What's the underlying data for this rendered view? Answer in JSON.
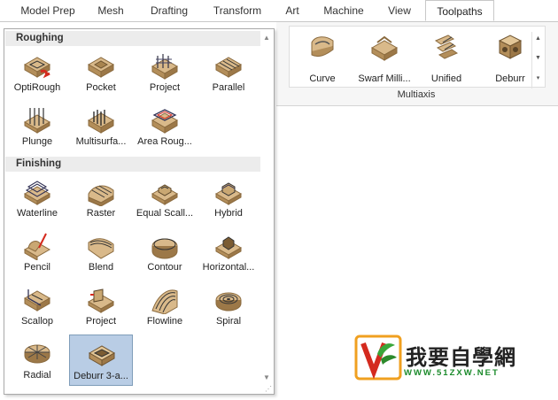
{
  "tabs": [
    {
      "label": "Model Prep",
      "active": false
    },
    {
      "label": "Mesh",
      "active": false
    },
    {
      "label": "Drafting",
      "active": false
    },
    {
      "label": "Transform",
      "active": false
    },
    {
      "label": "Art",
      "active": false
    },
    {
      "label": "Machine",
      "active": false
    },
    {
      "label": "View",
      "active": false
    },
    {
      "label": "Toolpaths",
      "active": true
    }
  ],
  "ribbon": {
    "group_label": "Multiaxis",
    "buttons": [
      {
        "label": "Curve",
        "icon": "multiaxis-curve-icon"
      },
      {
        "label": "Swarf Milli...",
        "icon": "swarf-milling-icon"
      },
      {
        "label": "Unified",
        "icon": "unified-icon"
      },
      {
        "label": "Deburr",
        "icon": "deburr-icon"
      }
    ]
  },
  "dropdown": {
    "sections": [
      {
        "title": "Roughing",
        "items": [
          {
            "label": "OptiRough",
            "icon": "optirough-icon"
          },
          {
            "label": "Pocket",
            "icon": "pocket-icon"
          },
          {
            "label": "Project",
            "icon": "project-icon"
          },
          {
            "label": "Parallel",
            "icon": "parallel-icon"
          },
          {
            "label": "Plunge",
            "icon": "plunge-icon"
          },
          {
            "label": "Multisurfa...",
            "icon": "multisurface-icon"
          },
          {
            "label": "Area Roug...",
            "icon": "area-roughing-icon"
          }
        ]
      },
      {
        "title": "Finishing",
        "items": [
          {
            "label": "Waterline",
            "icon": "waterline-icon"
          },
          {
            "label": "Raster",
            "icon": "raster-icon"
          },
          {
            "label": "Equal Scall...",
            "icon": "equal-scallop-icon"
          },
          {
            "label": "Hybrid",
            "icon": "hybrid-icon"
          },
          {
            "label": "Pencil",
            "icon": "pencil-icon"
          },
          {
            "label": "Blend",
            "icon": "blend-icon"
          },
          {
            "label": "Contour",
            "icon": "contour-icon"
          },
          {
            "label": "Horizontal...",
            "icon": "horizontal-icon"
          },
          {
            "label": "Scallop",
            "icon": "scallop-icon"
          },
          {
            "label": "Project",
            "icon": "project-finish-icon"
          },
          {
            "label": "Flowline",
            "icon": "flowline-icon"
          },
          {
            "label": "Spiral",
            "icon": "spiral-icon"
          },
          {
            "label": "Radial",
            "icon": "radial-icon"
          },
          {
            "label": "Deburr 3-a...",
            "icon": "deburr-3-axis-icon",
            "selected": true
          }
        ]
      }
    ]
  },
  "watermark": {
    "title": "我要自學網",
    "url": "WWW.51ZXW.NET"
  },
  "colors": {
    "part_tan": "#d9b98a",
    "part_dark": "#8a6a3e",
    "selection": "#b9cde5",
    "accent_red": "#d42a1e"
  }
}
